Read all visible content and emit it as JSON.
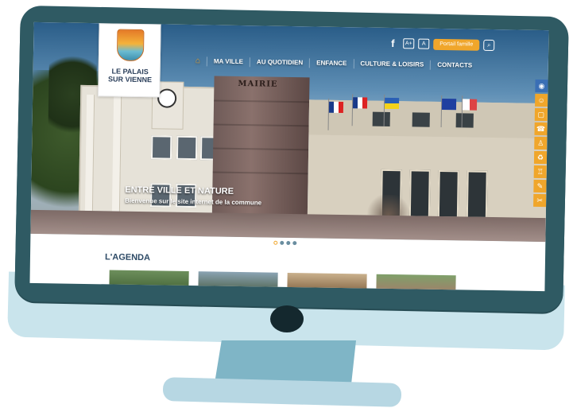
{
  "site": {
    "logo_text_line1": "LE PALAIS",
    "logo_text_line2": "SUR VIENNE",
    "logo_crest_text": ""
  },
  "topbar": {
    "facebook": "f",
    "font_increase": "A+",
    "font_decrease": "A",
    "portail_label": "Portail famille",
    "search_icon": "⌕"
  },
  "nav": {
    "home_icon": "⌂",
    "items": [
      "MA VILLE",
      "AU QUOTIDIEN",
      "ENFANCE",
      "CULTURE & LOISIRS",
      "CONTACTS"
    ]
  },
  "hero": {
    "title": "ENTRE VILLE ET NATURE",
    "subtitle": "Bienvenue sur le site internet de la commune",
    "building_sign": "MAIRIE",
    "slider_dots": 4,
    "active_dot": 0
  },
  "side_tools": [
    "◉",
    "☺",
    "▢",
    "☎",
    "♙",
    "♻",
    "♖",
    "✎",
    "✂"
  ],
  "agenda": {
    "title": "L'AGENDA"
  },
  "colors": {
    "accent": "#f0a62b",
    "brand_dark": "#2d4a66",
    "monitor": "#2f5a63"
  }
}
